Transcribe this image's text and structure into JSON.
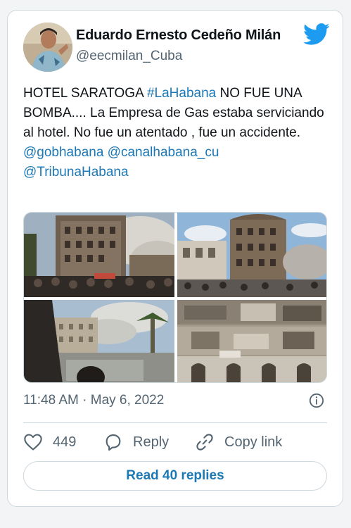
{
  "author": {
    "name": "Eduardo Ernesto Cedeño Milán",
    "handle": "@eecmilan_Cuba"
  },
  "tweet": {
    "text_part1": "HOTEL SARATOGA ",
    "hashtag": "#LaHabana",
    "text_part2": " NO FUE UNA BOMBA.... La Empresa de Gas estaba serviciando al hotel. No fue un atentado , fue un accidente.",
    "mention1": "@gobhabana",
    "mention2": "@canalhabana_cu",
    "mention3": "@TribunaHabana"
  },
  "timestamp": "11:48 AM · May 6, 2022",
  "actions": {
    "likes": "449",
    "reply_label": "Reply",
    "copy_link_label": "Copy link"
  },
  "read_replies_label": "Read 40 replies",
  "colors": {
    "link": "#1d78b6",
    "twitter_blue": "#1d9bf0",
    "muted": "#536471",
    "border": "#cfd9de"
  },
  "icons": [
    "twitter-bird-icon",
    "info-icon",
    "heart-icon",
    "reply-icon",
    "link-icon"
  ]
}
